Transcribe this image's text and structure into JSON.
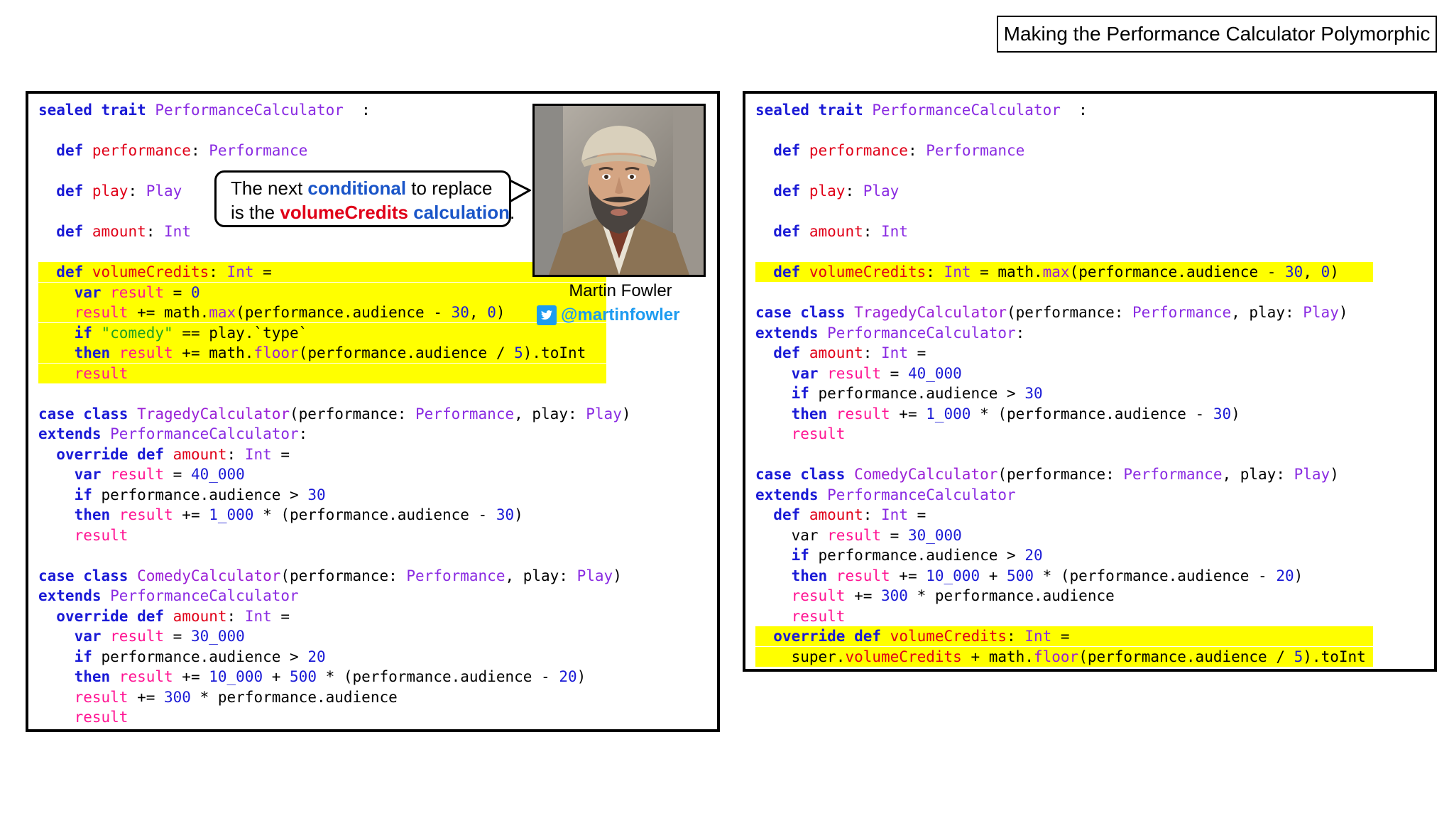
{
  "slide": {
    "title": "Making the Performance Calculator Polymorphic"
  },
  "bubble": {
    "line1": {
      "a": "The next ",
      "b": "conditional",
      "c": " to replace"
    },
    "line2": {
      "a": "is the ",
      "b": "volumeCredits",
      "c": " calculation",
      "d": "."
    }
  },
  "author": {
    "name": "Martin Fowler",
    "handle": "@martinfowler"
  },
  "left_code": [
    {
      "hl": false,
      "tokens": [
        [
          "k",
          "sealed trait "
        ],
        [
          "t",
          "PerformanceCalculator"
        ],
        [
          "",
          "  :"
        ]
      ]
    },
    {
      "hl": false,
      "tokens": []
    },
    {
      "hl": false,
      "tokens": [
        [
          "",
          "  "
        ],
        [
          "k",
          "def "
        ],
        [
          "n",
          "performance"
        ],
        [
          "",
          ": "
        ],
        [
          "t",
          "Performance"
        ]
      ]
    },
    {
      "hl": false,
      "tokens": []
    },
    {
      "hl": false,
      "tokens": [
        [
          "",
          "  "
        ],
        [
          "k",
          "def "
        ],
        [
          "n",
          "play"
        ],
        [
          "",
          ": "
        ],
        [
          "t",
          "Play"
        ]
      ]
    },
    {
      "hl": false,
      "tokens": []
    },
    {
      "hl": false,
      "tokens": [
        [
          "",
          "  "
        ],
        [
          "k",
          "def "
        ],
        [
          "n",
          "amount"
        ],
        [
          "",
          ": "
        ],
        [
          "t",
          "Int"
        ]
      ]
    },
    {
      "hl": false,
      "tokens": []
    },
    {
      "hl": true,
      "tokens": [
        [
          "",
          "  "
        ],
        [
          "k",
          "def "
        ],
        [
          "n",
          "volumeCredits"
        ],
        [
          "",
          ": "
        ],
        [
          "t",
          "Int"
        ],
        [
          "",
          " ="
        ]
      ]
    },
    {
      "hl": true,
      "tokens": [
        [
          "",
          "    "
        ],
        [
          "k",
          "var "
        ],
        [
          "v",
          "result"
        ],
        [
          "",
          " = "
        ],
        [
          "d",
          "0"
        ]
      ]
    },
    {
      "hl": true,
      "tokens": [
        [
          "",
          "    "
        ],
        [
          "v",
          "result"
        ],
        [
          "",
          " += math."
        ],
        [
          "m",
          "max"
        ],
        [
          "",
          "(performance.audience - "
        ],
        [
          "d",
          "30"
        ],
        [
          "",
          ", "
        ],
        [
          "d",
          "0"
        ],
        [
          "",
          ")"
        ]
      ]
    },
    {
      "hl": true,
      "tokens": [
        [
          "",
          "    "
        ],
        [
          "k",
          "if "
        ],
        [
          "s",
          "\"comedy\""
        ],
        [
          "",
          " == play.`type`"
        ]
      ]
    },
    {
      "hl": true,
      "tokens": [
        [
          "",
          "    "
        ],
        [
          "k",
          "then "
        ],
        [
          "v",
          "result"
        ],
        [
          "",
          " += math."
        ],
        [
          "m",
          "floor"
        ],
        [
          "",
          "(performance.audience / "
        ],
        [
          "d",
          "5"
        ],
        [
          "",
          ").toInt"
        ]
      ]
    },
    {
      "hl": true,
      "tokens": [
        [
          "",
          "    "
        ],
        [
          "v",
          "result"
        ]
      ]
    },
    {
      "hl": false,
      "tokens": []
    },
    {
      "hl": false,
      "tokens": [
        [
          "k",
          "case class "
        ],
        [
          "m",
          "TragedyCalculator"
        ],
        [
          "",
          "(performance: "
        ],
        [
          "t",
          "Performance"
        ],
        [
          "",
          ", play: "
        ],
        [
          "t",
          "Play"
        ],
        [
          "",
          ")"
        ]
      ]
    },
    {
      "hl": false,
      "tokens": [
        [
          "k",
          "extends "
        ],
        [
          "t",
          "PerformanceCalculator"
        ],
        [
          "",
          ":"
        ]
      ]
    },
    {
      "hl": false,
      "tokens": [
        [
          "",
          "  "
        ],
        [
          "k",
          "override def "
        ],
        [
          "n",
          "amount"
        ],
        [
          "",
          ": "
        ],
        [
          "t",
          "Int"
        ],
        [
          "",
          " ="
        ]
      ]
    },
    {
      "hl": false,
      "tokens": [
        [
          "",
          "    "
        ],
        [
          "k",
          "var "
        ],
        [
          "v",
          "result"
        ],
        [
          "",
          " = "
        ],
        [
          "d",
          "40_000"
        ]
      ]
    },
    {
      "hl": false,
      "tokens": [
        [
          "",
          "    "
        ],
        [
          "k",
          "if "
        ],
        [
          "",
          "performance.audience > "
        ],
        [
          "d",
          "30"
        ]
      ]
    },
    {
      "hl": false,
      "tokens": [
        [
          "",
          "    "
        ],
        [
          "k",
          "then "
        ],
        [
          "v",
          "result"
        ],
        [
          "",
          " += "
        ],
        [
          "d",
          "1_000"
        ],
        [
          "",
          " * (performance.audience - "
        ],
        [
          "d",
          "30"
        ],
        [
          "",
          ")"
        ]
      ]
    },
    {
      "hl": false,
      "tokens": [
        [
          "",
          "    "
        ],
        [
          "v",
          "result"
        ]
      ]
    },
    {
      "hl": false,
      "tokens": []
    },
    {
      "hl": false,
      "tokens": [
        [
          "k",
          "case class "
        ],
        [
          "m",
          "ComedyCalculator"
        ],
        [
          "",
          "(performance: "
        ],
        [
          "t",
          "Performance"
        ],
        [
          "",
          ", play: "
        ],
        [
          "t",
          "Play"
        ],
        [
          "",
          ")"
        ]
      ]
    },
    {
      "hl": false,
      "tokens": [
        [
          "k",
          "extends "
        ],
        [
          "t",
          "PerformanceCalculator"
        ]
      ]
    },
    {
      "hl": false,
      "tokens": [
        [
          "",
          "  "
        ],
        [
          "k",
          "override def "
        ],
        [
          "n",
          "amount"
        ],
        [
          "",
          ": "
        ],
        [
          "t",
          "Int"
        ],
        [
          "",
          " ="
        ]
      ]
    },
    {
      "hl": false,
      "tokens": [
        [
          "",
          "    "
        ],
        [
          "k",
          "var "
        ],
        [
          "v",
          "result"
        ],
        [
          "",
          " = "
        ],
        [
          "d",
          "30_000"
        ]
      ]
    },
    {
      "hl": false,
      "tokens": [
        [
          "",
          "    "
        ],
        [
          "k",
          "if "
        ],
        [
          "",
          "performance.audience > "
        ],
        [
          "d",
          "20"
        ]
      ]
    },
    {
      "hl": false,
      "tokens": [
        [
          "",
          "    "
        ],
        [
          "k",
          "then "
        ],
        [
          "v",
          "result"
        ],
        [
          "",
          " += "
        ],
        [
          "d",
          "10_000"
        ],
        [
          "",
          " + "
        ],
        [
          "d",
          "500"
        ],
        [
          "",
          " * (performance.audience - "
        ],
        [
          "d",
          "20"
        ],
        [
          "",
          ")"
        ]
      ]
    },
    {
      "hl": false,
      "tokens": [
        [
          "",
          "    "
        ],
        [
          "v",
          "result"
        ],
        [
          "",
          " += "
        ],
        [
          "d",
          "300"
        ],
        [
          "",
          " * performance.audience"
        ]
      ]
    },
    {
      "hl": false,
      "tokens": [
        [
          "",
          "    "
        ],
        [
          "v",
          "result"
        ]
      ]
    }
  ],
  "right_code": [
    {
      "hl": false,
      "tokens": [
        [
          "k",
          "sealed trait "
        ],
        [
          "t",
          "PerformanceCalculator"
        ],
        [
          "",
          "  :"
        ]
      ]
    },
    {
      "hl": false,
      "tokens": []
    },
    {
      "hl": false,
      "tokens": [
        [
          "",
          "  "
        ],
        [
          "k",
          "def "
        ],
        [
          "n",
          "performance"
        ],
        [
          "",
          ": "
        ],
        [
          "t",
          "Performance"
        ]
      ]
    },
    {
      "hl": false,
      "tokens": []
    },
    {
      "hl": false,
      "tokens": [
        [
          "",
          "  "
        ],
        [
          "k",
          "def "
        ],
        [
          "n",
          "play"
        ],
        [
          "",
          ": "
        ],
        [
          "t",
          "Play"
        ]
      ]
    },
    {
      "hl": false,
      "tokens": []
    },
    {
      "hl": false,
      "tokens": [
        [
          "",
          "  "
        ],
        [
          "k",
          "def "
        ],
        [
          "n",
          "amount"
        ],
        [
          "",
          ": "
        ],
        [
          "t",
          "Int"
        ]
      ]
    },
    {
      "hl": false,
      "tokens": []
    },
    {
      "hl": true,
      "tokens": [
        [
          "",
          "  "
        ],
        [
          "k",
          "def "
        ],
        [
          "n",
          "volumeCredits"
        ],
        [
          "",
          ": "
        ],
        [
          "t",
          "Int"
        ],
        [
          "",
          " = math."
        ],
        [
          "m",
          "max"
        ],
        [
          "",
          "(performance.audience - "
        ],
        [
          "d",
          "30"
        ],
        [
          "",
          ", "
        ],
        [
          "d",
          "0"
        ],
        [
          "",
          ")"
        ]
      ]
    },
    {
      "hl": false,
      "tokens": []
    },
    {
      "hl": false,
      "tokens": [
        [
          "k",
          "case class "
        ],
        [
          "m",
          "TragedyCalculator"
        ],
        [
          "",
          "(performance: "
        ],
        [
          "t",
          "Performance"
        ],
        [
          "",
          ", play: "
        ],
        [
          "t",
          "Play"
        ],
        [
          "",
          ")"
        ]
      ]
    },
    {
      "hl": false,
      "tokens": [
        [
          "k",
          "extends "
        ],
        [
          "t",
          "PerformanceCalculator"
        ],
        [
          "",
          ":"
        ]
      ]
    },
    {
      "hl": false,
      "tokens": [
        [
          "",
          "  "
        ],
        [
          "k",
          "def "
        ],
        [
          "n",
          "amount"
        ],
        [
          "",
          ": "
        ],
        [
          "t",
          "Int"
        ],
        [
          "",
          " ="
        ]
      ]
    },
    {
      "hl": false,
      "tokens": [
        [
          "",
          "    "
        ],
        [
          "k",
          "var "
        ],
        [
          "v",
          "result"
        ],
        [
          "",
          " = "
        ],
        [
          "d",
          "40_000"
        ]
      ]
    },
    {
      "hl": false,
      "tokens": [
        [
          "",
          "    "
        ],
        [
          "k",
          "if "
        ],
        [
          "",
          "performance.audience > "
        ],
        [
          "d",
          "30"
        ]
      ]
    },
    {
      "hl": false,
      "tokens": [
        [
          "",
          "    "
        ],
        [
          "k",
          "then "
        ],
        [
          "v",
          "result"
        ],
        [
          "",
          " += "
        ],
        [
          "d",
          "1_000"
        ],
        [
          "",
          " * (performance.audience - "
        ],
        [
          "d",
          "30"
        ],
        [
          "",
          ")"
        ]
      ]
    },
    {
      "hl": false,
      "tokens": [
        [
          "",
          "    "
        ],
        [
          "v",
          "result"
        ]
      ]
    },
    {
      "hl": false,
      "tokens": []
    },
    {
      "hl": false,
      "tokens": [
        [
          "k",
          "case class "
        ],
        [
          "m",
          "ComedyCalculator"
        ],
        [
          "",
          "(performance: "
        ],
        [
          "t",
          "Performance"
        ],
        [
          "",
          ", play: "
        ],
        [
          "t",
          "Play"
        ],
        [
          "",
          ")"
        ]
      ]
    },
    {
      "hl": false,
      "tokens": [
        [
          "k",
          "extends "
        ],
        [
          "t",
          "PerformanceCalculator"
        ]
      ]
    },
    {
      "hl": false,
      "tokens": [
        [
          "",
          "  "
        ],
        [
          "k",
          "def "
        ],
        [
          "n",
          "amount"
        ],
        [
          "",
          ": "
        ],
        [
          "t",
          "Int"
        ],
        [
          "",
          " ="
        ]
      ]
    },
    {
      "hl": false,
      "tokens": [
        [
          "",
          "    var "
        ],
        [
          "v",
          "result"
        ],
        [
          "",
          " = "
        ],
        [
          "d",
          "30_000"
        ]
      ]
    },
    {
      "hl": false,
      "tokens": [
        [
          "",
          "    "
        ],
        [
          "k",
          "if "
        ],
        [
          "",
          "performance.audience > "
        ],
        [
          "d",
          "20"
        ]
      ]
    },
    {
      "hl": false,
      "tokens": [
        [
          "",
          "    "
        ],
        [
          "k",
          "then "
        ],
        [
          "v",
          "result"
        ],
        [
          "",
          " += "
        ],
        [
          "d",
          "10_000"
        ],
        [
          "",
          " + "
        ],
        [
          "d",
          "500"
        ],
        [
          "",
          " * (performance.audience - "
        ],
        [
          "d",
          "20"
        ],
        [
          "",
          ")"
        ]
      ]
    },
    {
      "hl": false,
      "tokens": [
        [
          "",
          "    "
        ],
        [
          "v",
          "result"
        ],
        [
          "",
          " += "
        ],
        [
          "d",
          "300"
        ],
        [
          "",
          " * performance.audience"
        ]
      ]
    },
    {
      "hl": false,
      "tokens": [
        [
          "",
          "    "
        ],
        [
          "v",
          "result"
        ]
      ]
    },
    {
      "hl": true,
      "tokens": [
        [
          "",
          "  "
        ],
        [
          "k",
          "override def "
        ],
        [
          "n",
          "volumeCredits"
        ],
        [
          "",
          ": "
        ],
        [
          "t",
          "Int"
        ],
        [
          "",
          " ="
        ]
      ]
    },
    {
      "hl": true,
      "tokens": [
        [
          "",
          "    super."
        ],
        [
          "n",
          "volumeCredits"
        ],
        [
          "",
          " + math."
        ],
        [
          "m",
          "floor"
        ],
        [
          "",
          "(performance.audience / "
        ],
        [
          "d",
          "5"
        ],
        [
          "",
          ").toInt"
        ]
      ]
    }
  ]
}
